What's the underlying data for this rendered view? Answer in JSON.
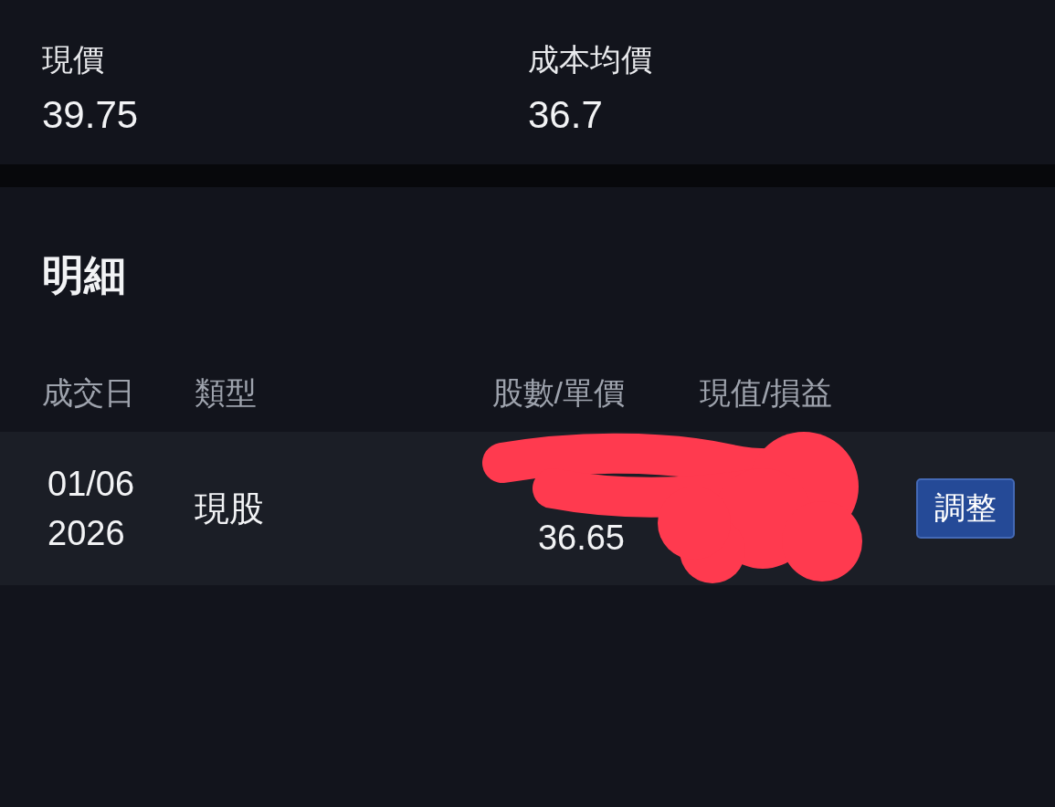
{
  "summary": [
    {
      "label": "現價",
      "value": "39.75"
    },
    {
      "label": "成本均價",
      "value": "36.7"
    }
  ],
  "detail": {
    "title": "明細",
    "columns": [
      "成交日",
      "類型",
      "股數/單價",
      "現值/損益"
    ],
    "rows": [
      {
        "date": "01/06",
        "year": "2026",
        "type": "現股",
        "price": "36.65",
        "button": "調整"
      }
    ]
  }
}
